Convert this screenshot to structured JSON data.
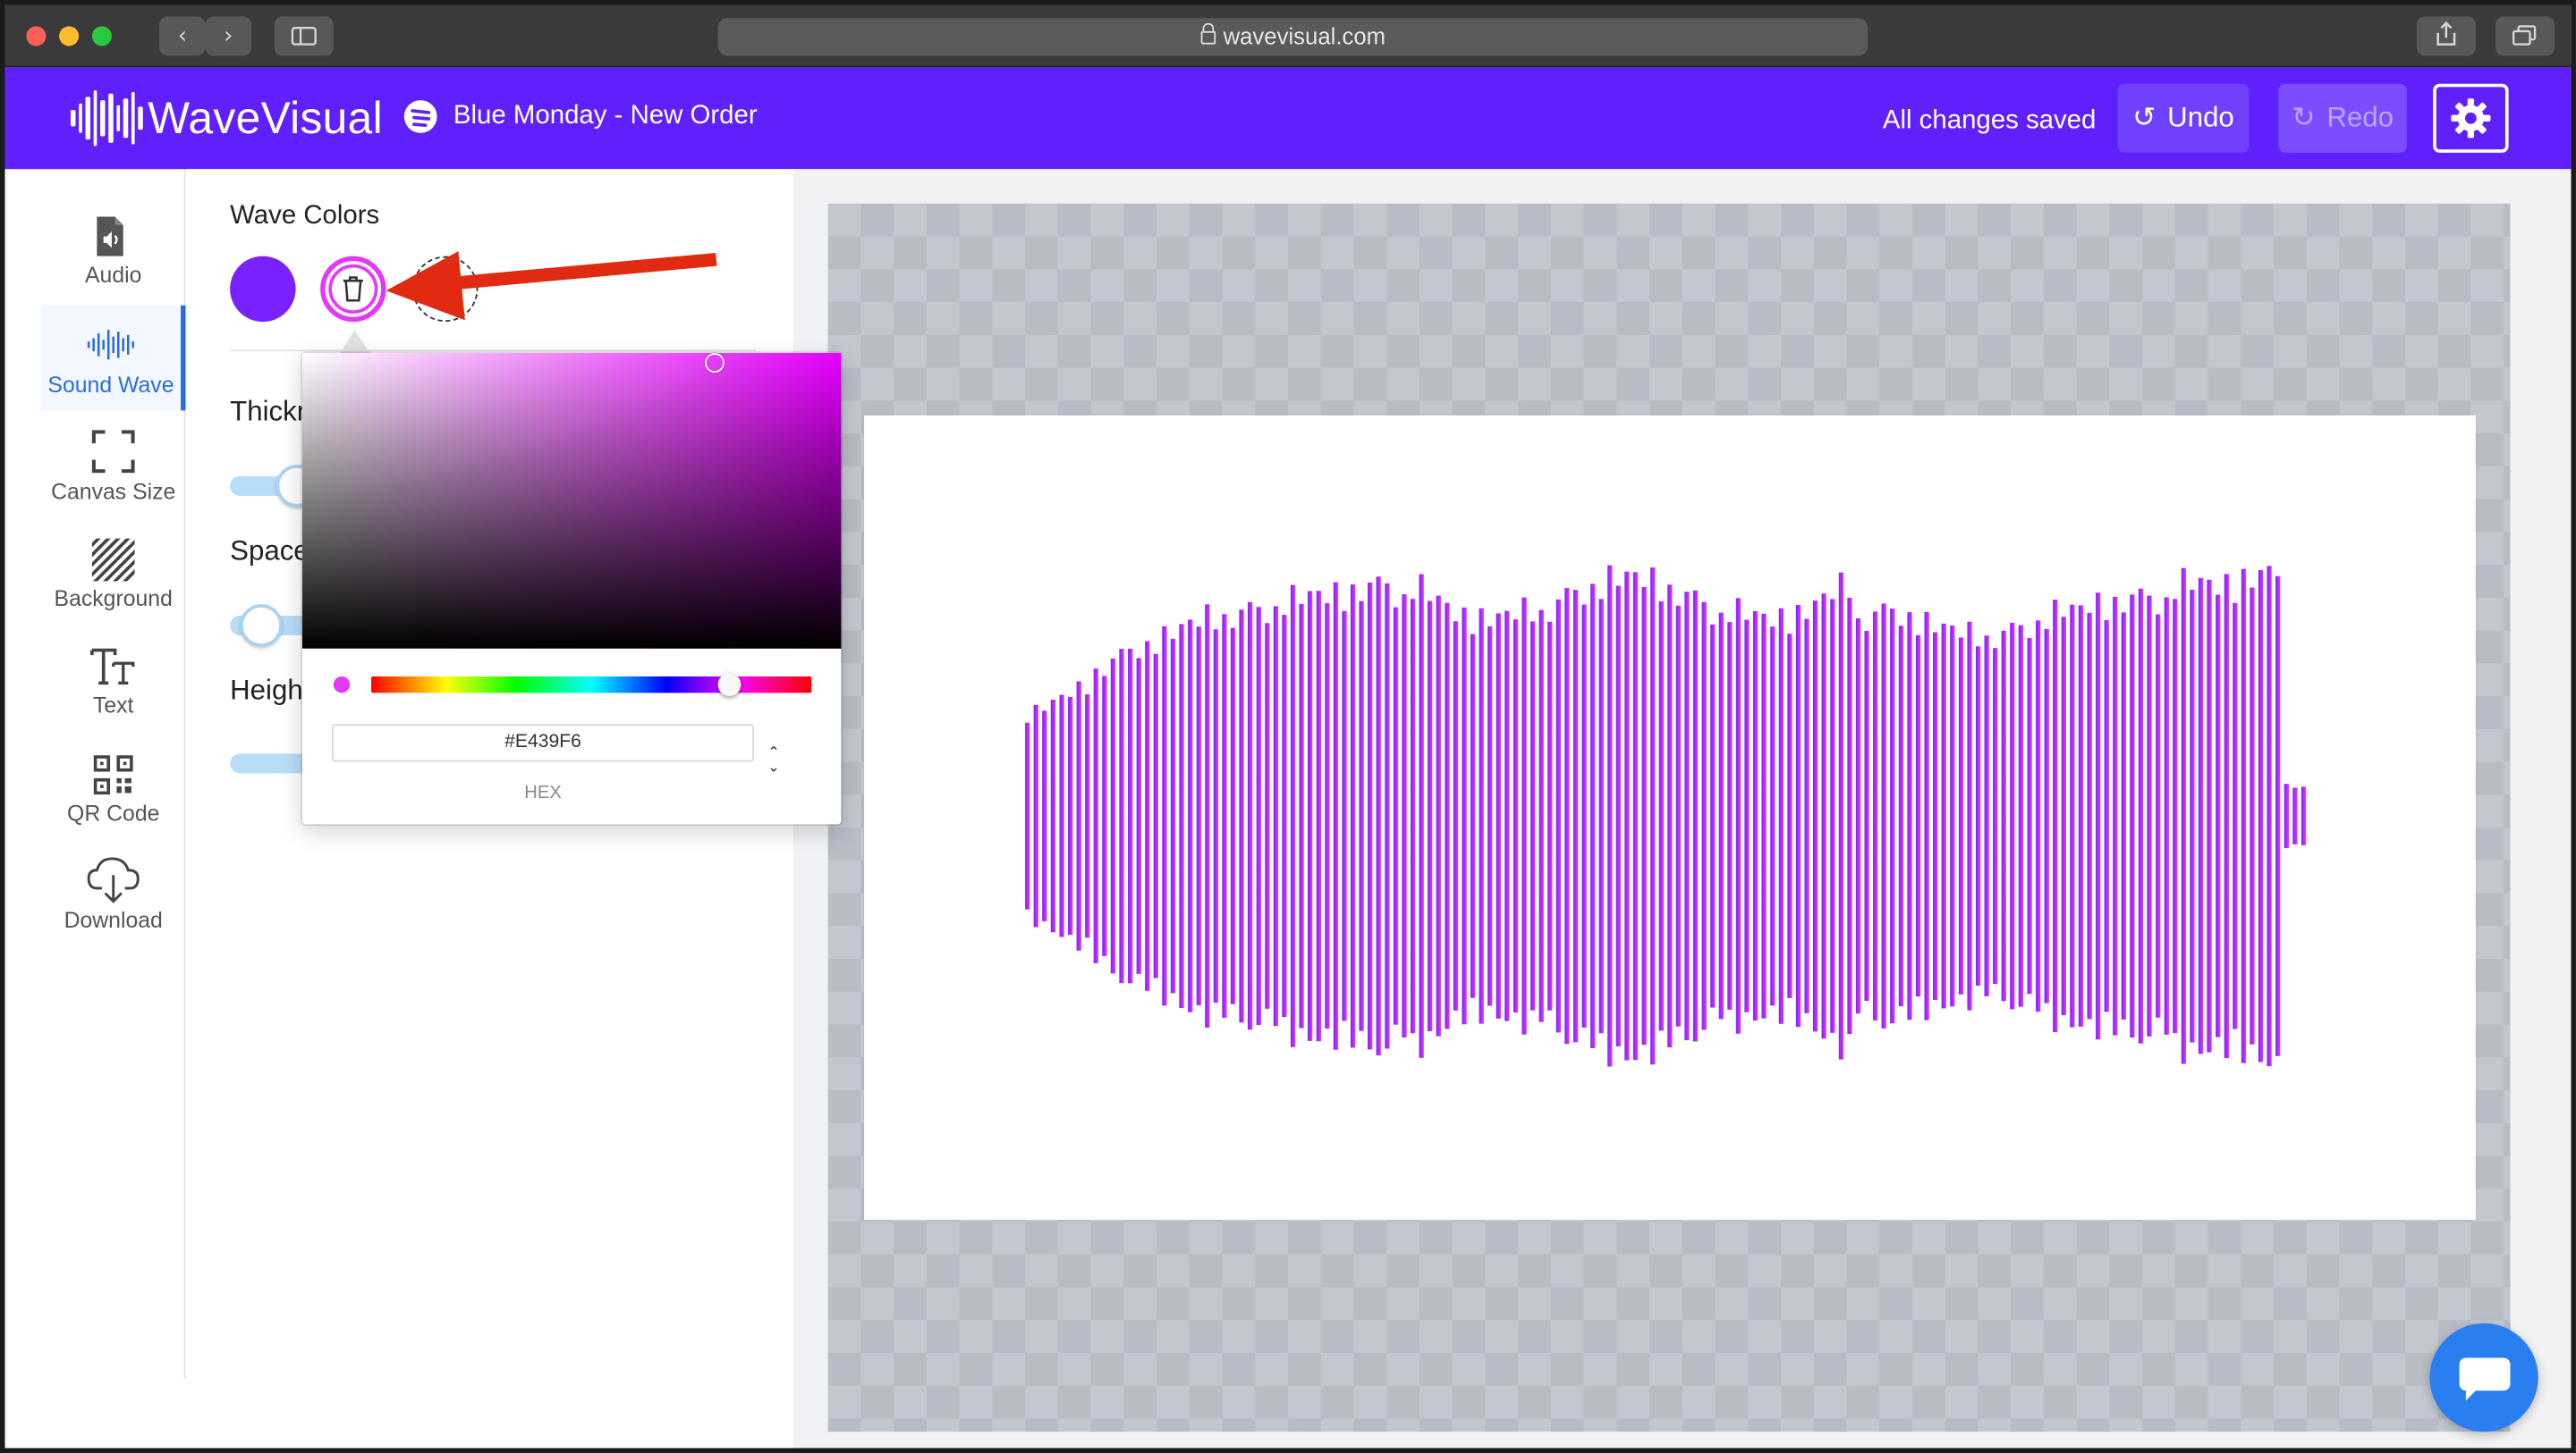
{
  "browser": {
    "url": "wavevisual.com"
  },
  "app": {
    "logo_text": "WaveVisual",
    "track_title": "Blue Monday - New Order",
    "save_status": "All changes saved",
    "undo_label": "Undo",
    "redo_label": "Redo"
  },
  "sidebar": {
    "items": [
      {
        "label": "Audio",
        "icon": "audio-file-icon"
      },
      {
        "label": "Sound Wave",
        "icon": "sound-wave-icon",
        "active": true
      },
      {
        "label": "Canvas Size",
        "icon": "canvas-size-icon"
      },
      {
        "label": "Background",
        "icon": "background-icon"
      },
      {
        "label": "Text",
        "icon": "text-icon"
      },
      {
        "label": "QR Code",
        "icon": "qr-code-icon"
      },
      {
        "label": "Download",
        "icon": "download-icon"
      }
    ]
  },
  "panel": {
    "wave_colors_title": "Wave Colors",
    "thickness_title": "Thickn",
    "spacing_title": "Space",
    "height_title": "Heigh",
    "colors": [
      "#7a22fb",
      "#e439f6"
    ]
  },
  "color_picker": {
    "hex_value": "#E439F6",
    "hex_label": "HEX"
  },
  "theme": {
    "header_bg": "#6020fb",
    "accent_blue": "#2a6ddb",
    "wave_start": "#7a22fb",
    "wave_end": "#e439f6"
  }
}
